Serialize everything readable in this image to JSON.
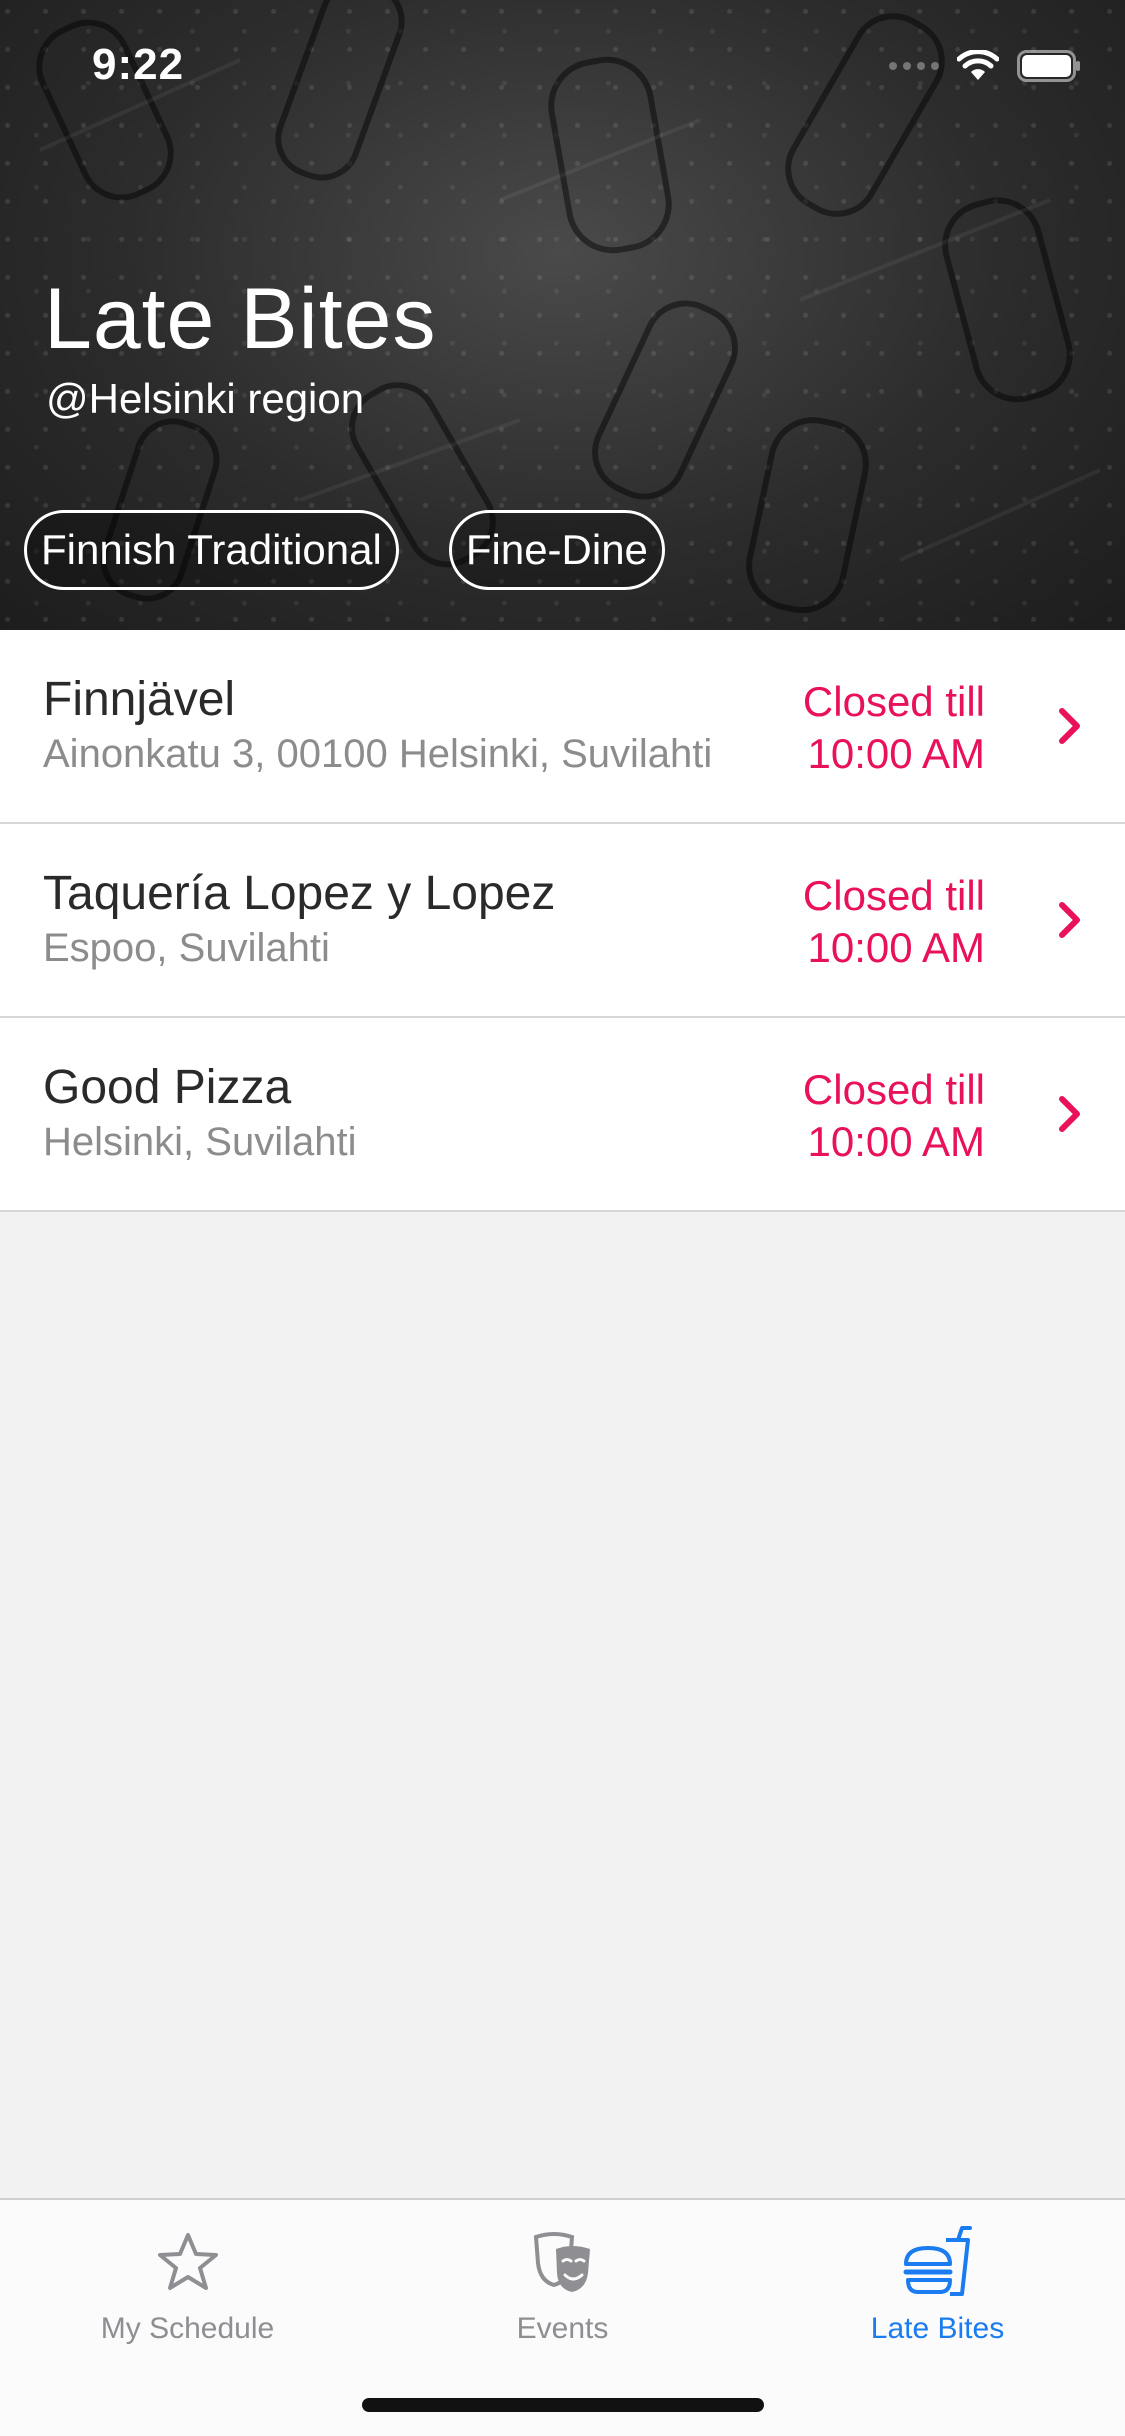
{
  "status_bar": {
    "time": "9:22"
  },
  "header": {
    "title": "Late Bites",
    "subtitle": "@Helsinki region",
    "chips": [
      "Finnish Traditional",
      "Fine-Dine"
    ]
  },
  "restaurants": [
    {
      "name": "Finnjävel",
      "address": "Ainonkatu 3, 00100 Helsinki, Suvilahti",
      "status_line1": "Closed till",
      "status_line2": "10:00 AM"
    },
    {
      "name": "Taquería Lopez y Lopez",
      "address": "Espoo, Suvilahti",
      "status_line1": "Closed till",
      "status_line2": "10:00 AM"
    },
    {
      "name": "Good Pizza",
      "address": "Helsinki, Suvilahti",
      "status_line1": "Closed till",
      "status_line2": "10:00 AM"
    }
  ],
  "tabbar": {
    "tabs": [
      {
        "label": "My Schedule",
        "icon": "star-icon",
        "active": false
      },
      {
        "label": "Events",
        "icon": "theater-mask-icon",
        "active": false
      },
      {
        "label": "Late Bites",
        "icon": "burger-drink-icon",
        "active": true
      }
    ]
  },
  "colors": {
    "accent": "#e8115a",
    "tab_active": "#1a7cf0",
    "tab_inactive": "#8e8e93",
    "background": "#f2f2f2"
  }
}
